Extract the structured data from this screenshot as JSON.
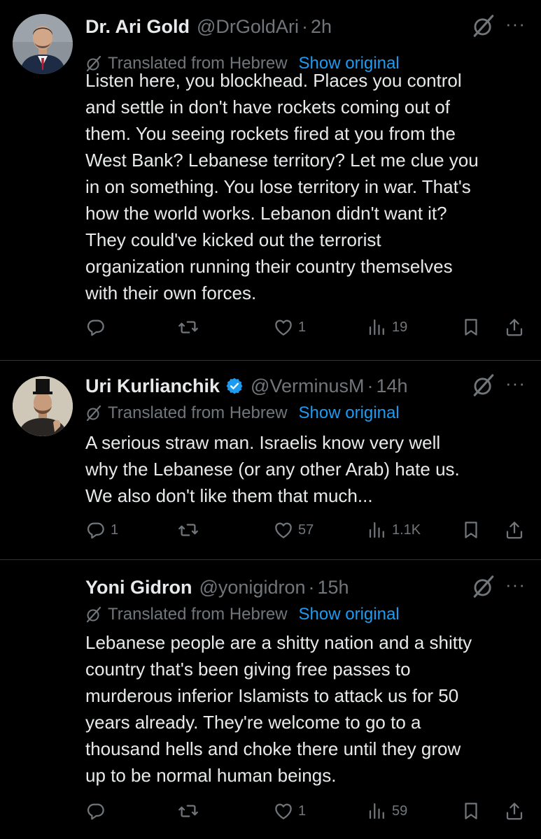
{
  "tweets": [
    {
      "name": "Dr. Ari Gold",
      "verified": false,
      "handle": "@DrGoldAri",
      "separator": "·",
      "time": "2h",
      "translated_label": "Translated from Hebrew",
      "show_original": "Show original",
      "more": "···",
      "body_lines": [
        "Listen here, you blockhead. Places you control",
        "and settle in don't have rockets coming out of",
        "them. You seeing rockets fired at you from the",
        "West Bank? Lebanese territory? Let me clue you",
        "in on something. You lose territory in war. That's",
        "how the world works. Lebanon didn't want it?",
        "They could've kicked out the terrorist",
        "organization running their country themselves",
        "with their own forces."
      ],
      "replies": "",
      "reposts": "",
      "likes": "1",
      "views": "19"
    },
    {
      "name": "Uri Kurlianchik",
      "verified": true,
      "handle": "@VerminusM",
      "separator": "·",
      "time": "14h",
      "translated_label": "Translated from Hebrew",
      "show_original": "Show original",
      "more": "···",
      "body_lines": [
        "A serious straw man. Israelis know very well",
        "why the Lebanese (or any other Arab) hate us.",
        "We also don't like them that much..."
      ],
      "replies": "1",
      "reposts": "",
      "likes": "57",
      "views": "1.1K"
    },
    {
      "name": "Yoni Gidron",
      "verified": false,
      "handle": "@yonigidron",
      "separator": "·",
      "time": "15h",
      "translated_label": "Translated from Hebrew",
      "show_original": "Show original",
      "more": "···",
      "body_lines": [
        "Lebanese people are a shitty nation and a shitty",
        "country that's been giving free passes to",
        "murderous inferior Islamists to attack us for 50",
        "years already. They're welcome to go to a",
        "thousand hells and choke there until they grow",
        "up to be normal human beings."
      ],
      "replies": "",
      "reposts": "",
      "likes": "1",
      "views": "59"
    }
  ],
  "colors": {
    "background": "#000000",
    "text": "#e7e9ea",
    "muted": "#71767b",
    "link": "#1d9bf0",
    "divider": "#2f3336",
    "verified": "#1d9bf0"
  }
}
